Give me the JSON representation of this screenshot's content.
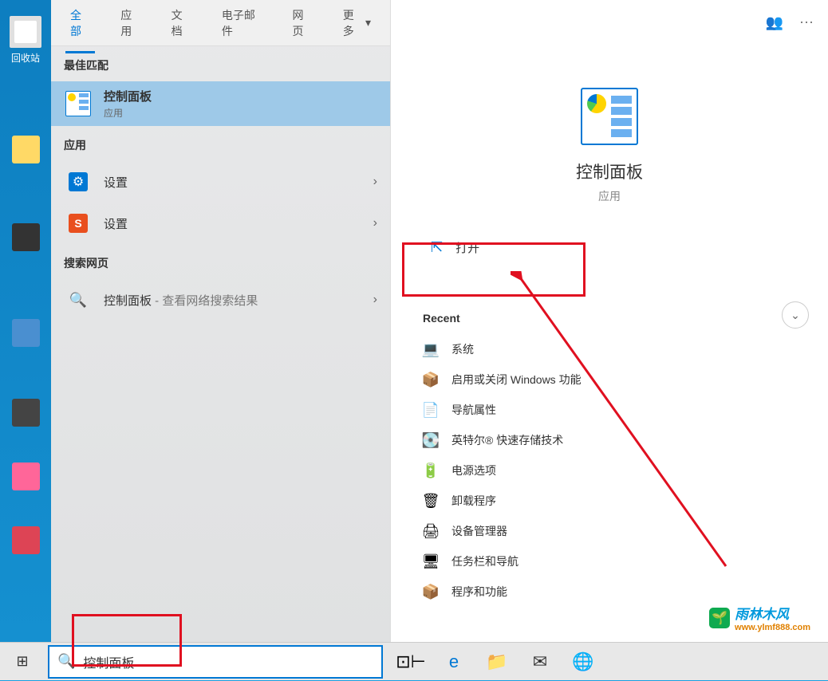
{
  "desktop": {
    "recycle_bin": "回收站"
  },
  "tabs": {
    "all": "全部",
    "apps": "应用",
    "docs": "文档",
    "email": "电子邮件",
    "web": "网页",
    "more": "更多"
  },
  "left": {
    "best_match": "最佳匹配",
    "selected": {
      "title": "控制面板",
      "sub": "应用"
    },
    "apps_header": "应用",
    "settings1": "设置",
    "settings2": "设置",
    "web_header": "搜索网页",
    "web_item_prefix": "控制面板",
    "web_item_suffix": " - 查看网络搜索结果"
  },
  "right": {
    "title": "控制面板",
    "sub": "应用",
    "open": "打开",
    "recent_header": "Recent",
    "items": [
      "系统",
      "启用或关闭 Windows 功能",
      "导航属性",
      "英特尔® 快速存储技术",
      "电源选项",
      "卸载程序",
      "设备管理器",
      "任务栏和导航",
      "程序和功能"
    ]
  },
  "search": {
    "value": "控制面板"
  },
  "watermark": {
    "name": "雨林木风",
    "url": "www.ylmf888.com"
  }
}
